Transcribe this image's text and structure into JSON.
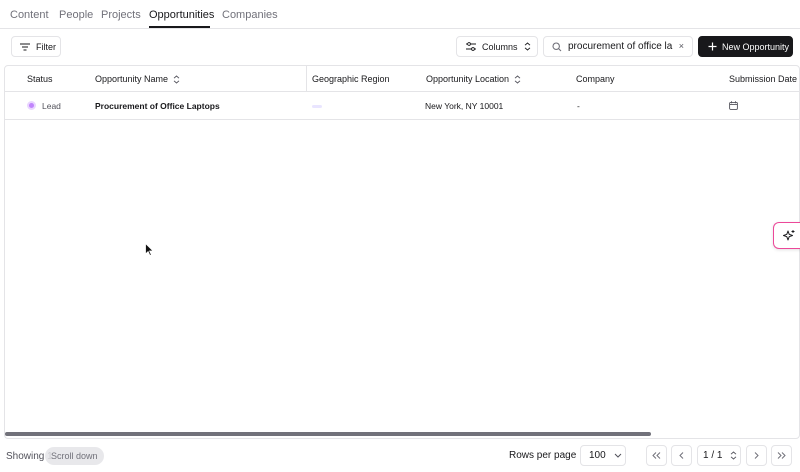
{
  "tabs": [
    {
      "label": "Content"
    },
    {
      "label": "People"
    },
    {
      "label": "Projects"
    },
    {
      "label": "Opportunities",
      "active": true
    },
    {
      "label": "Companies"
    }
  ],
  "toolbar": {
    "filter_label": "Filter",
    "columns_label": "Columns",
    "search_value": "procurement of office la",
    "clear_symbol": "×",
    "new_label": "New Opportunity"
  },
  "table": {
    "columns": [
      "Status",
      "Opportunity Name",
      "Geographic Region",
      "Opportunity Location",
      "Company",
      "Submission Date"
    ],
    "rows": [
      {
        "status": "Lead",
        "name": "Procurement of Office Laptops",
        "region": "",
        "location": "New York, NY 10001",
        "company": "-",
        "submission_date": ""
      }
    ]
  },
  "footer": {
    "showing_text": "Showing 1",
    "toast_text": "Scroll down",
    "rows_per_page_label": "Rows per page",
    "rows_per_page_value": "100",
    "page_value": "1 / 1"
  },
  "colors": {
    "accent_dark": "#18181b",
    "status_lead": "#c084fc",
    "ai_border": "#ec4899"
  },
  "icons": [
    "filter-icon",
    "columns-icon",
    "search-icon",
    "plus-icon",
    "sort-icon",
    "calendar-icon",
    "sparkle-icon",
    "chevron-updown-icon",
    "first-page-icon",
    "prev-page-icon",
    "next-page-icon",
    "last-page-icon"
  ]
}
